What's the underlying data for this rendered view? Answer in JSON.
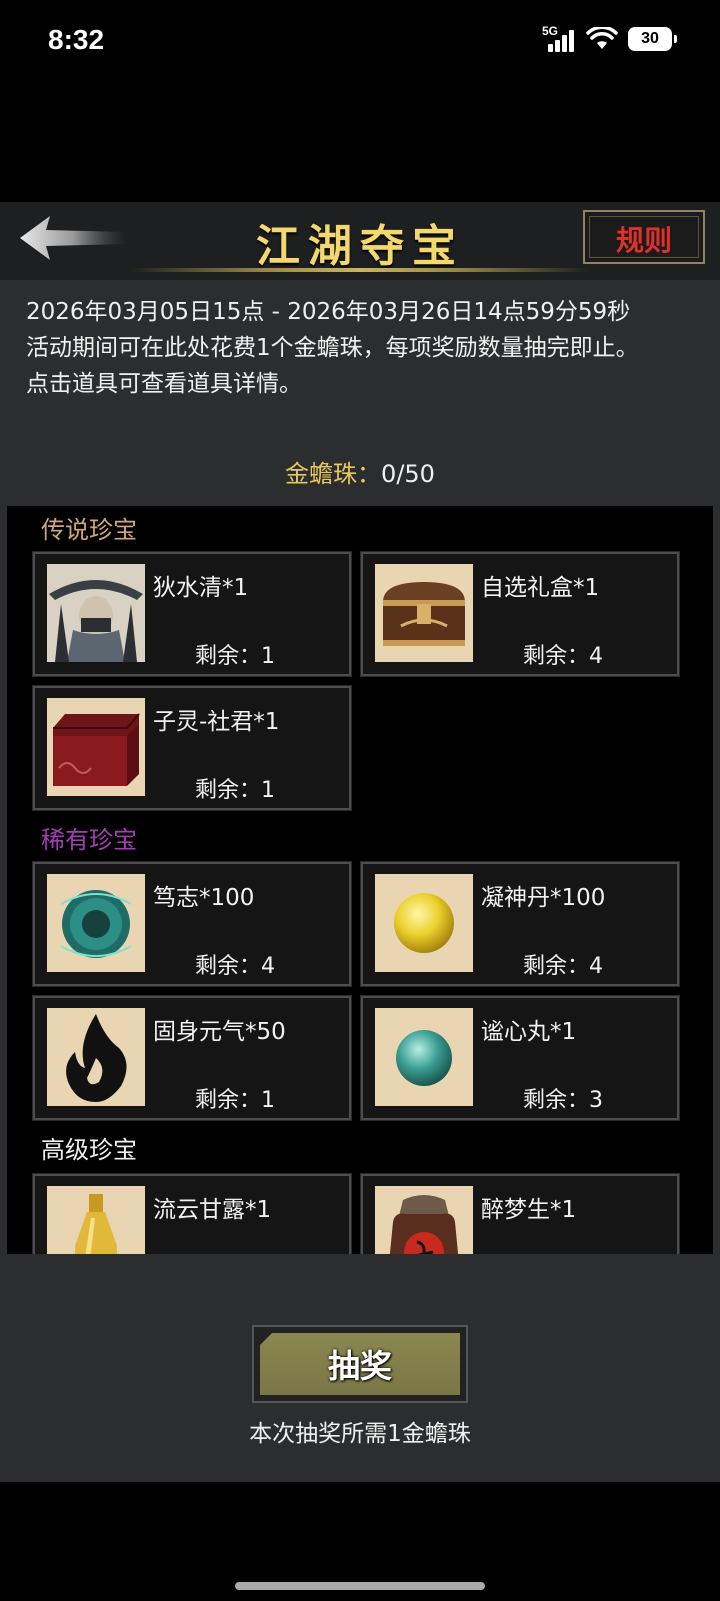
{
  "status_bar": {
    "time": "8:32",
    "network": "5G",
    "battery": "30"
  },
  "header": {
    "title": "江湖夺宝",
    "rules_label": "规则"
  },
  "description": {
    "line1": "2026年03月05日15点 - 2026年03月26日14点59分59秒",
    "line2": "活动期间可在此处花费1个金蟾珠，每项奖励数量抽完即止。",
    "line3": "点击道具可查看道具详情。"
  },
  "currency": {
    "label": "金蟾珠：",
    "value": "0/50"
  },
  "colors": {
    "legendary": "#cfa77a",
    "rare": "#a33fb3",
    "advanced": "#f0f0f0",
    "title_gold": "#f2d86e",
    "rules_red": "#e0302a"
  },
  "sections": [
    {
      "title": "传说珍宝",
      "items": [
        {
          "name": "狄水清*1",
          "remaining": "剩余：1",
          "icon": "character-portrait-icon"
        },
        {
          "name": "自选礼盒*1",
          "remaining": "剩余：4",
          "icon": "treasure-chest-icon"
        },
        {
          "name": "子灵-社君*1",
          "remaining": "剩余：1",
          "icon": "red-box-icon"
        }
      ]
    },
    {
      "title": "稀有珍宝",
      "items": [
        {
          "name": "笃志*100",
          "remaining": "剩余：4",
          "icon": "jade-orb-icon"
        },
        {
          "name": "凝神丹*100",
          "remaining": "剩余：4",
          "icon": "golden-pill-icon"
        },
        {
          "name": "固身元气*50",
          "remaining": "剩余：1",
          "icon": "black-flame-icon"
        },
        {
          "name": "谧心丸*1",
          "remaining": "剩余：3",
          "icon": "teal-pill-icon"
        }
      ]
    },
    {
      "title": "高级珍宝",
      "items": [
        {
          "name": "流云甘露*1",
          "remaining": "",
          "icon": "gold-vase-icon"
        },
        {
          "name": "醉梦生*1",
          "remaining": "",
          "icon": "wine-jar-icon"
        }
      ]
    }
  ],
  "draw": {
    "button_label": "抽奖",
    "cost_text": "本次抽奖所需1金蟾珠"
  }
}
